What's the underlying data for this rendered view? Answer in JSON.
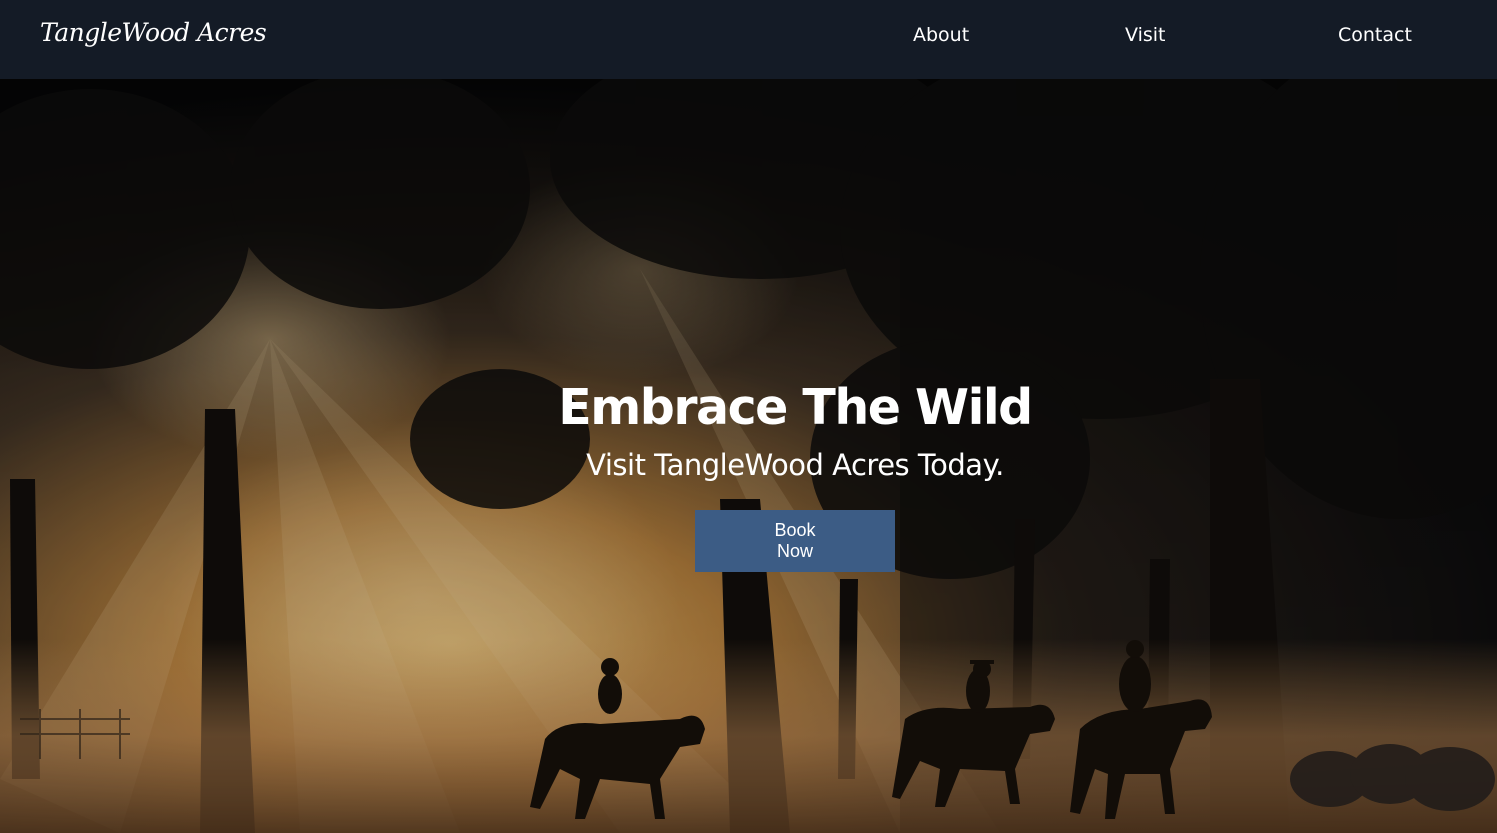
{
  "brand": {
    "logo_text": "TangleWood Acres"
  },
  "nav": {
    "items": [
      {
        "label": "About"
      },
      {
        "label": "Visit"
      },
      {
        "label": "Contact"
      }
    ]
  },
  "hero": {
    "title": "Embrace The Wild",
    "subtitle": "Visit TangleWood Acres Today.",
    "cta_line1": "Book",
    "cta_line2": "Now",
    "background_description_icon": "forest-sunrise-riders-photo"
  },
  "colors": {
    "navbar_bg": "#141b26",
    "button_bg": "#3c5c85",
    "text": "#ffffff",
    "sunlight": "#e8b060"
  }
}
